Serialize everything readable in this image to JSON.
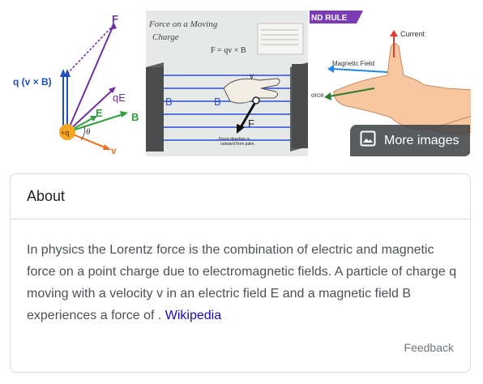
{
  "images": {
    "tile1": {
      "labels": {
        "f": "F",
        "qvb": "q (v × B)",
        "qe": "qE",
        "e": "E",
        "b": "B",
        "charge": "+q",
        "theta": "θ",
        "v": "v"
      }
    },
    "tile2": {
      "title_line1": "Force on a Moving",
      "title_line2": "Charge",
      "formula": "F = qv × B",
      "b_label1": "B",
      "b_label2": "B",
      "v_label": "v",
      "f_label": "F",
      "caption1": "Force direction is",
      "caption2": "outward from palm."
    },
    "tile3": {
      "banner": "ND RULE",
      "current": "Current",
      "magnetic_field": "Magnetic Field",
      "force": "orce"
    },
    "more_images_label": "More images"
  },
  "about": {
    "title": "About",
    "description": "In physics the Lorentz force is the combination of electric and magnetic force on a point charge due to electromagnetic fields. A particle of charge q moving with a velocity v in an electric field E and a magnetic field B experiences a force of . ",
    "source_link": "Wikipedia",
    "feedback": "Feedback"
  }
}
